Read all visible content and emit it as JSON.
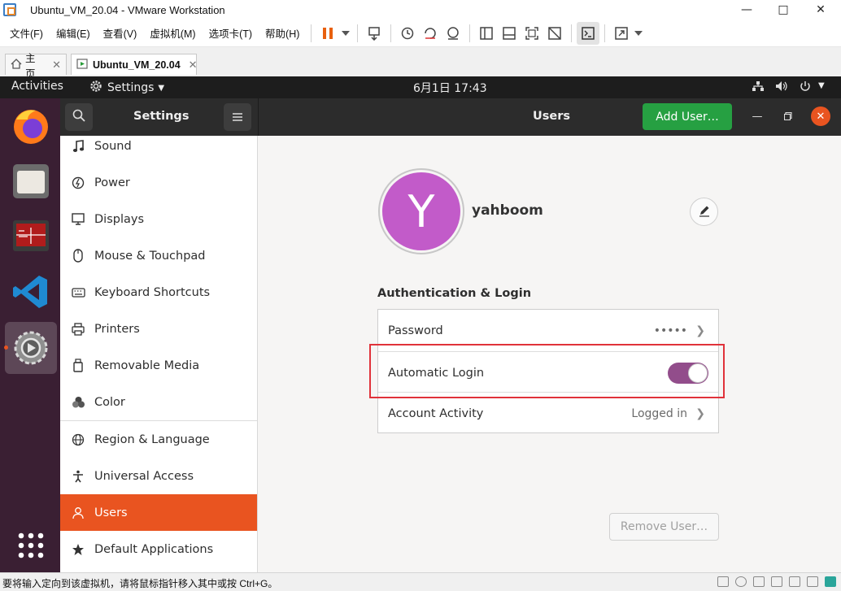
{
  "window": {
    "title": "Ubuntu_VM_20.04 - VMware Workstation",
    "minimize_icon": "minimize-icon",
    "maximize_icon": "maximize-icon",
    "close_icon": "close-icon"
  },
  "menu": {
    "items": [
      "文件(F)",
      "编辑(E)",
      "查看(V)",
      "虚拟机(M)",
      "选项卡(T)",
      "帮助(H)"
    ]
  },
  "tabs": [
    {
      "label": "主页",
      "icon": "home-icon"
    },
    {
      "label": "Ubuntu_VM_20.04",
      "icon": "vm-icon"
    }
  ],
  "ubuntu_bar": {
    "activities": "Activities",
    "app_menu": "Settings",
    "clock": "6月1日  17:43"
  },
  "settings": {
    "title": "Settings",
    "panel_title": "Users",
    "add_user_label": "Add User…"
  },
  "sidebar": {
    "items": [
      {
        "label": "Sound",
        "icon": "music-note-icon"
      },
      {
        "label": "Power",
        "icon": "power-icon"
      },
      {
        "label": "Displays",
        "icon": "display-icon"
      },
      {
        "label": "Mouse & Touchpad",
        "icon": "mouse-icon"
      },
      {
        "label": "Keyboard Shortcuts",
        "icon": "keyboard-icon"
      },
      {
        "label": "Printers",
        "icon": "printer-icon"
      },
      {
        "label": "Removable Media",
        "icon": "removable-media-icon"
      },
      {
        "label": "Color",
        "icon": "color-icon"
      },
      {
        "label": "Region & Language",
        "icon": "globe-icon"
      },
      {
        "label": "Universal Access",
        "icon": "accessibility-icon"
      },
      {
        "label": "Users",
        "icon": "users-icon"
      },
      {
        "label": "Default Applications",
        "icon": "star-icon"
      }
    ],
    "active": "Users"
  },
  "user": {
    "initial": "Y",
    "name": "yahboom",
    "avatar_color": "#c25bc9"
  },
  "auth": {
    "section_title": "Authentication & Login",
    "password_label": "Password",
    "password_value": "•••••",
    "auto_login_label": "Automatic Login",
    "auto_login_enabled": true,
    "activity_label": "Account Activity",
    "activity_value": "Logged in"
  },
  "remove_user_label": "Remove User…",
  "statusbar": {
    "text": "要将输入定向到该虚拟机，请将鼠标指针移入其中或按 Ctrl+G。"
  },
  "colors": {
    "accent": "#e95420",
    "toggle_on": "#924d8b",
    "add_button": "#26a042",
    "highlight_box": "#e0323a"
  }
}
